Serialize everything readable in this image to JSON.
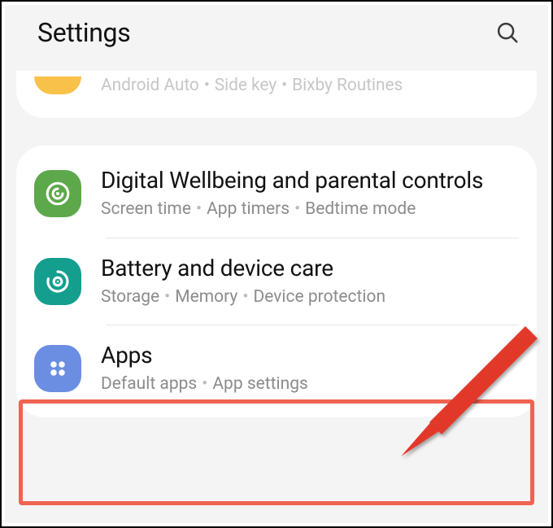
{
  "header": {
    "title": "Settings"
  },
  "cut_row": {
    "subtitle_parts": [
      "Android Auto",
      "Side key",
      "Bixby Routines"
    ]
  },
  "rows": [
    {
      "id": "wellbeing",
      "title": "Digital Wellbeing and parental controls",
      "subtitle_parts": [
        "Screen time",
        "App timers",
        "Bedtime mode"
      ],
      "icon_color": "#5DA84B"
    },
    {
      "id": "battery",
      "title": "Battery and device care",
      "subtitle_parts": [
        "Storage",
        "Memory",
        "Device protection"
      ],
      "icon_color": "#139E8E"
    },
    {
      "id": "apps",
      "title": "Apps",
      "subtitle_parts": [
        "Default apps",
        "App settings"
      ],
      "icon_color": "#6B8EE3"
    }
  ]
}
